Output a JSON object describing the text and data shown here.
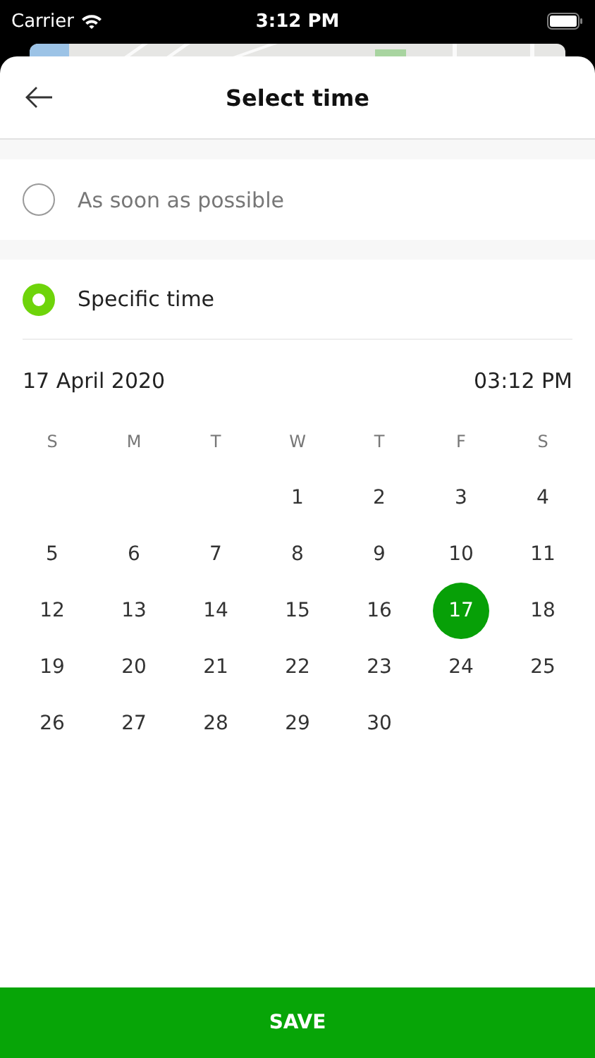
{
  "status_bar": {
    "carrier": "Carrier",
    "time": "3:12 PM"
  },
  "header": {
    "title": "Select time"
  },
  "options": [
    {
      "label": "As soon as possible",
      "selected": false
    },
    {
      "label": "Specific time",
      "selected": true
    }
  ],
  "calendar": {
    "date": "17 April 2020",
    "time": "03:12 PM",
    "weekdays": [
      "S",
      "M",
      "T",
      "W",
      "T",
      "F",
      "S"
    ],
    "weeks": [
      [
        {
          "label": "1",
          "selected": false
        },
        {
          "label": "2",
          "selected": false
        },
        {
          "label": "3",
          "selected": false
        },
        {
          "label": "4",
          "selected": false
        }
      ],
      [
        {
          "label": "5",
          "selected": false
        },
        {
          "label": "6",
          "selected": false
        },
        {
          "label": "7",
          "selected": false
        },
        {
          "label": "8",
          "selected": false
        },
        {
          "label": "9",
          "selected": false
        },
        {
          "label": "10",
          "selected": false
        },
        {
          "label": "11",
          "selected": false
        }
      ],
      [
        {
          "label": "12",
          "selected": false
        },
        {
          "label": "13",
          "selected": false
        },
        {
          "label": "14",
          "selected": false
        },
        {
          "label": "15",
          "selected": false
        },
        {
          "label": "16",
          "selected": false
        },
        {
          "label": "17",
          "selected": true
        },
        {
          "label": "18",
          "selected": false
        }
      ],
      [
        {
          "label": "19",
          "selected": false
        },
        {
          "label": "20",
          "selected": false
        },
        {
          "label": "21",
          "selected": false
        },
        {
          "label": "22",
          "selected": false
        },
        {
          "label": "23",
          "selected": false
        },
        {
          "label": "24",
          "selected": false
        },
        {
          "label": "25",
          "selected": false
        }
      ],
      [
        {
          "label": "26",
          "selected": false
        },
        {
          "label": "27",
          "selected": false
        },
        {
          "label": "28",
          "selected": false
        },
        {
          "label": "29",
          "selected": false
        },
        {
          "label": "30",
          "selected": false
        }
      ]
    ]
  },
  "save_button": "SAVE"
}
